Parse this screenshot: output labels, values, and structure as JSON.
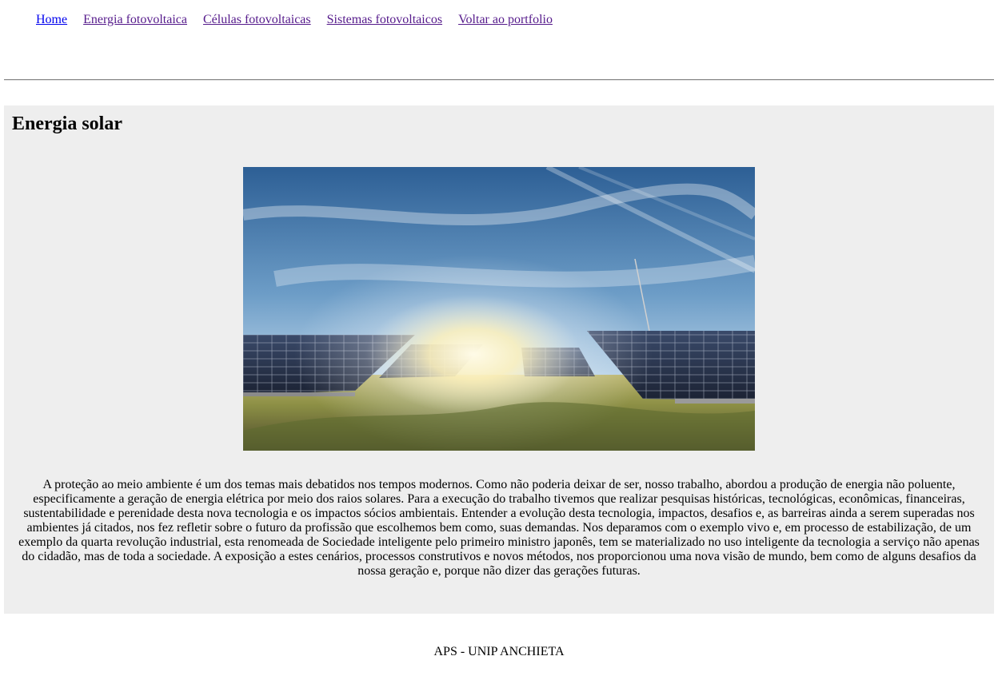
{
  "nav": {
    "items": [
      {
        "label": "Home"
      },
      {
        "label": "Energia fotovoltaica"
      },
      {
        "label": "Células fotovoltaicas"
      },
      {
        "label": "Sistemas fotovoltaicos"
      },
      {
        "label": "Voltar ao portfolio"
      }
    ]
  },
  "main": {
    "title": "Energia solar",
    "image": {
      "icon": "solar-panels-photo"
    },
    "paragraph": "A proteção ao meio ambiente é um dos temas mais debatidos nos tempos modernos. Como não poderia deixar de ser, nosso trabalho, abordou a produção de energia não poluente, especificamente a geração de energia elétrica por meio dos raios solares. Para a execução do trabalho tivemos que realizar pesquisas históricas, tecnológicas, econômicas, financeiras, sustentabilidade e perenidade desta nova tecnologia e os impactos sócios ambientais. Entender a evolução desta tecnologia, impactos, desafios e, as barreiras ainda a serem superadas nos ambientes já citados, nos fez refletir sobre o futuro da profissão que escolhemos bem como, suas demandas. Nos deparamos com o exemplo vivo e, em processo de estabilização, de um exemplo da quarta revolução industrial, esta renomeada de Sociedade inteligente pelo primeiro ministro japonês, tem se materializado no uso inteligente da tecnologia a serviço não apenas do cidadão, mas de toda a sociedade. A exposição a estes cenários, processos construtivos e novos métodos, nos proporcionou uma nova visão de mundo, bem como de alguns desafios da nossa geração e, porque não dizer das gerações futuras."
  },
  "footer": {
    "text": "APS - UNIP ANCHIETA"
  },
  "colors": {
    "link": "#0000ee",
    "visited": "#551a8b",
    "panel": "#eeeeee"
  }
}
